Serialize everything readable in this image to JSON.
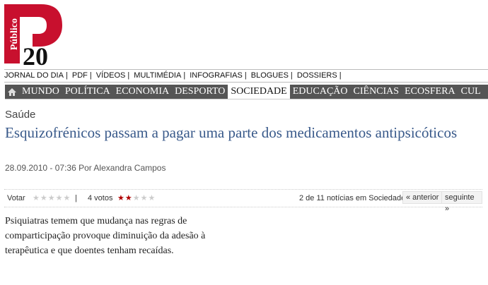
{
  "logo": {
    "side_text": "Público",
    "number": "20"
  },
  "top_nav": [
    "JORNAL DO DIA",
    "PDF",
    "VÍDEOS",
    "MULTIMÉDIA",
    "INFOGRAFIAS",
    "BLOGUES",
    "DOSSIERS"
  ],
  "sections": [
    "MUNDO",
    "POLÍTICA",
    "ECONOMIA",
    "DESPORTO",
    "SOCIEDADE",
    "EDUCAÇÃO",
    "CIÊNCIAS",
    "ECOSFERA",
    "CUL"
  ],
  "active_section": "SOCIEDADE",
  "article": {
    "category": "Saúde",
    "title": "Esquizofrénicos passam a pagar uma parte dos medicamentos antipsicóticos",
    "byline": "28.09.2010 - 07:36 Por Alexandra Campos",
    "lead": "Psiquiatras temem que mudança nas regras de comparticipação provoque diminuição da adesão à terapêutica e que doentes tenham recaídas."
  },
  "toolbar": {
    "vote_label": "Votar",
    "vote_stars": 0,
    "separator": "|",
    "votes_label": "4 votos",
    "rating_stars": 2,
    "max_stars": 5,
    "news_count": "2 de 11 notícias em Sociedade",
    "prev_label": "« anterior",
    "next_label": "seguinte »"
  },
  "colors": {
    "brand_red": "#c8102e",
    "headline_blue": "#38598a",
    "section_bar": "#555555",
    "star_on": "#b00000"
  }
}
